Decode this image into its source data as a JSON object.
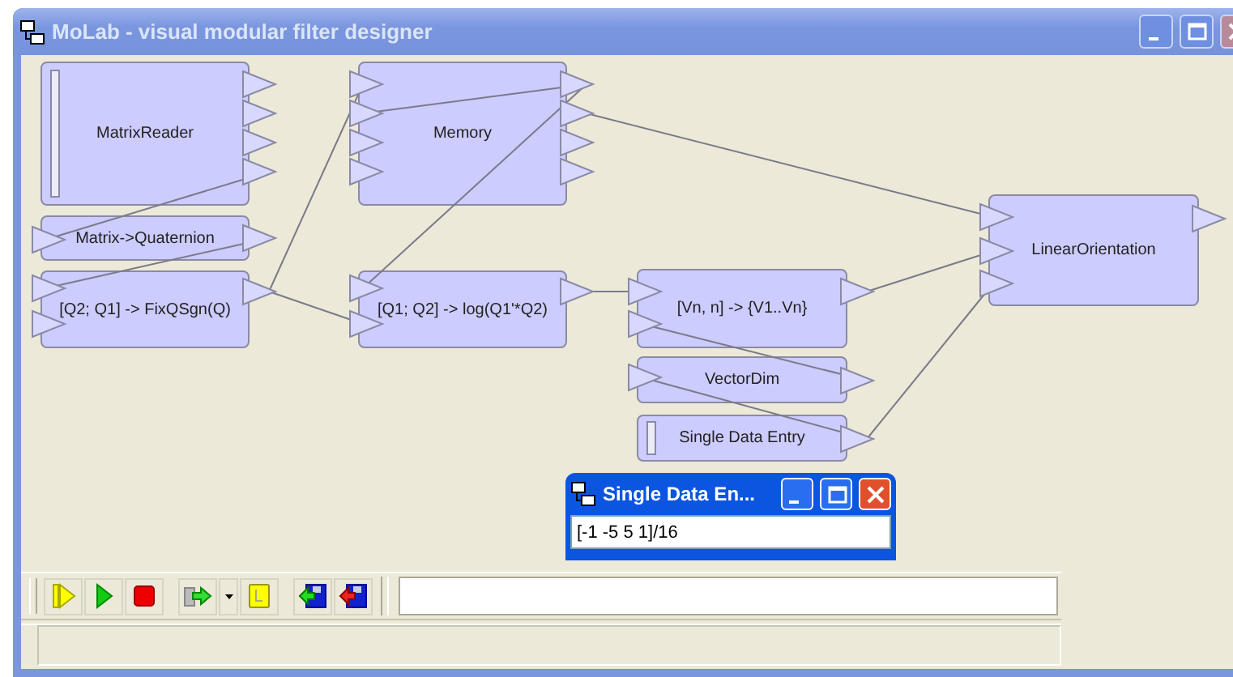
{
  "window": {
    "title": "MoLab - visual modular filter designer"
  },
  "blocks": [
    {
      "label": "MatrixReader",
      "kind": "source"
    },
    {
      "label": "Matrix->Quaternion",
      "kind": "filter"
    },
    {
      "label": "[Q2; Q1] -> FixQSgn(Q)",
      "kind": "filter"
    },
    {
      "label": "Memory",
      "kind": "filter"
    },
    {
      "label": "[Q1; Q2] -> log(Q1'*Q2)",
      "kind": "filter"
    },
    {
      "label": "[Vn, n] -> {V1..Vn}",
      "kind": "filter"
    },
    {
      "label": "VectorDim",
      "kind": "filter"
    },
    {
      "label": "Single Data Entry",
      "kind": "source"
    },
    {
      "label": "LinearOrientation",
      "kind": "filter"
    }
  ],
  "dialog": {
    "title": "Single Data En...",
    "value": "[-1 -5 5 1]/16"
  }
}
